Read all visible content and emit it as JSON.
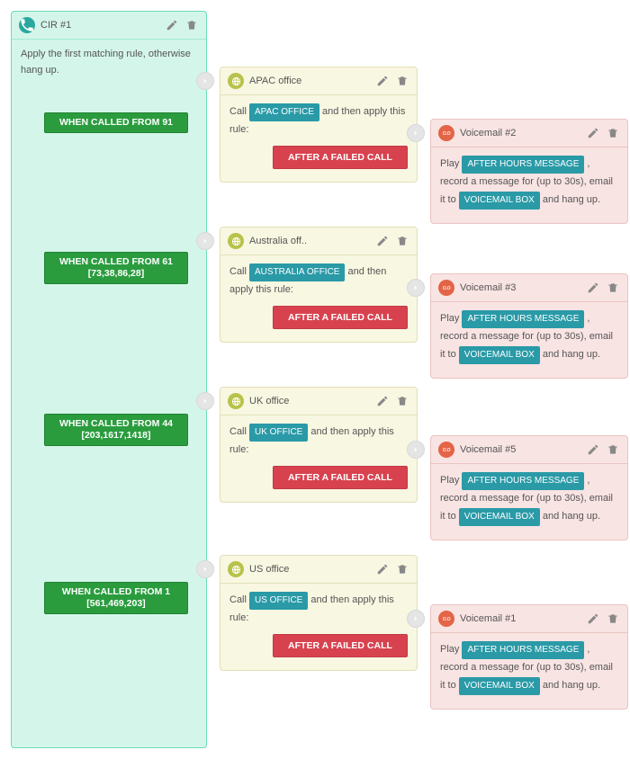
{
  "cir": {
    "title": "CIR #1",
    "description": "Apply the first matching rule, otherwise hang up.",
    "rules": [
      {
        "label": "WHEN CALLED FROM 91"
      },
      {
        "label": "WHEN CALLED FROM 61 [73,38,86,28]"
      },
      {
        "label": "WHEN CALLED FROM 44 [203,1617,1418]"
      },
      {
        "label": "WHEN CALLED FROM 1 [561,469,203]"
      }
    ]
  },
  "offices": [
    {
      "title": "APAC office",
      "call_prefix": "Call",
      "office_tag": "APAC OFFICE",
      "call_suffix": "and then apply this rule:",
      "fail_label": "AFTER A FAILED CALL"
    },
    {
      "title": "Australia off..",
      "call_prefix": "Call",
      "office_tag": "AUSTRALIA OFFICE",
      "call_suffix": "and then apply this rule:",
      "fail_label": "AFTER A FAILED CALL"
    },
    {
      "title": "UK office",
      "call_prefix": "Call",
      "office_tag": "UK OFFICE",
      "call_suffix": "and then apply this rule:",
      "fail_label": "AFTER A FAILED CALL"
    },
    {
      "title": "US office",
      "call_prefix": "Call",
      "office_tag": "US OFFICE",
      "call_suffix": "and then apply this rule:",
      "fail_label": "AFTER A FAILED CALL"
    }
  ],
  "voicemails": [
    {
      "title": "Voicemail #2",
      "play": "Play",
      "msg_tag": "AFTER HOURS MESSAGE",
      "rec": ", record a message for (up to 30s), email it to",
      "box_tag": "VOICEMAIL BOX",
      "end": "and hang up."
    },
    {
      "title": "Voicemail #3",
      "play": "Play",
      "msg_tag": "AFTER HOURS MESSAGE",
      "rec": ", record a message for (up to 30s), email it to",
      "box_tag": "VOICEMAIL BOX",
      "end": "and hang up."
    },
    {
      "title": "Voicemail #5",
      "play": "Play",
      "msg_tag": "AFTER HOURS MESSAGE",
      "rec": ", record a message for (up to 30s), email it to",
      "box_tag": "VOICEMAIL BOX",
      "end": "and hang up."
    },
    {
      "title": "Voicemail #1",
      "play": "Play",
      "msg_tag": "AFTER HOURS MESSAGE",
      "rec": ", record a message for (up to 30s), email it to",
      "box_tag": "VOICEMAIL BOX",
      "end": "and hang up."
    }
  ],
  "spacing": {
    "ruleTops": [
      30,
      185,
      365,
      552
    ],
    "officeTops": [
      0,
      178,
      356,
      543
    ],
    "vmTops": [
      58,
      230,
      410,
      598
    ]
  }
}
